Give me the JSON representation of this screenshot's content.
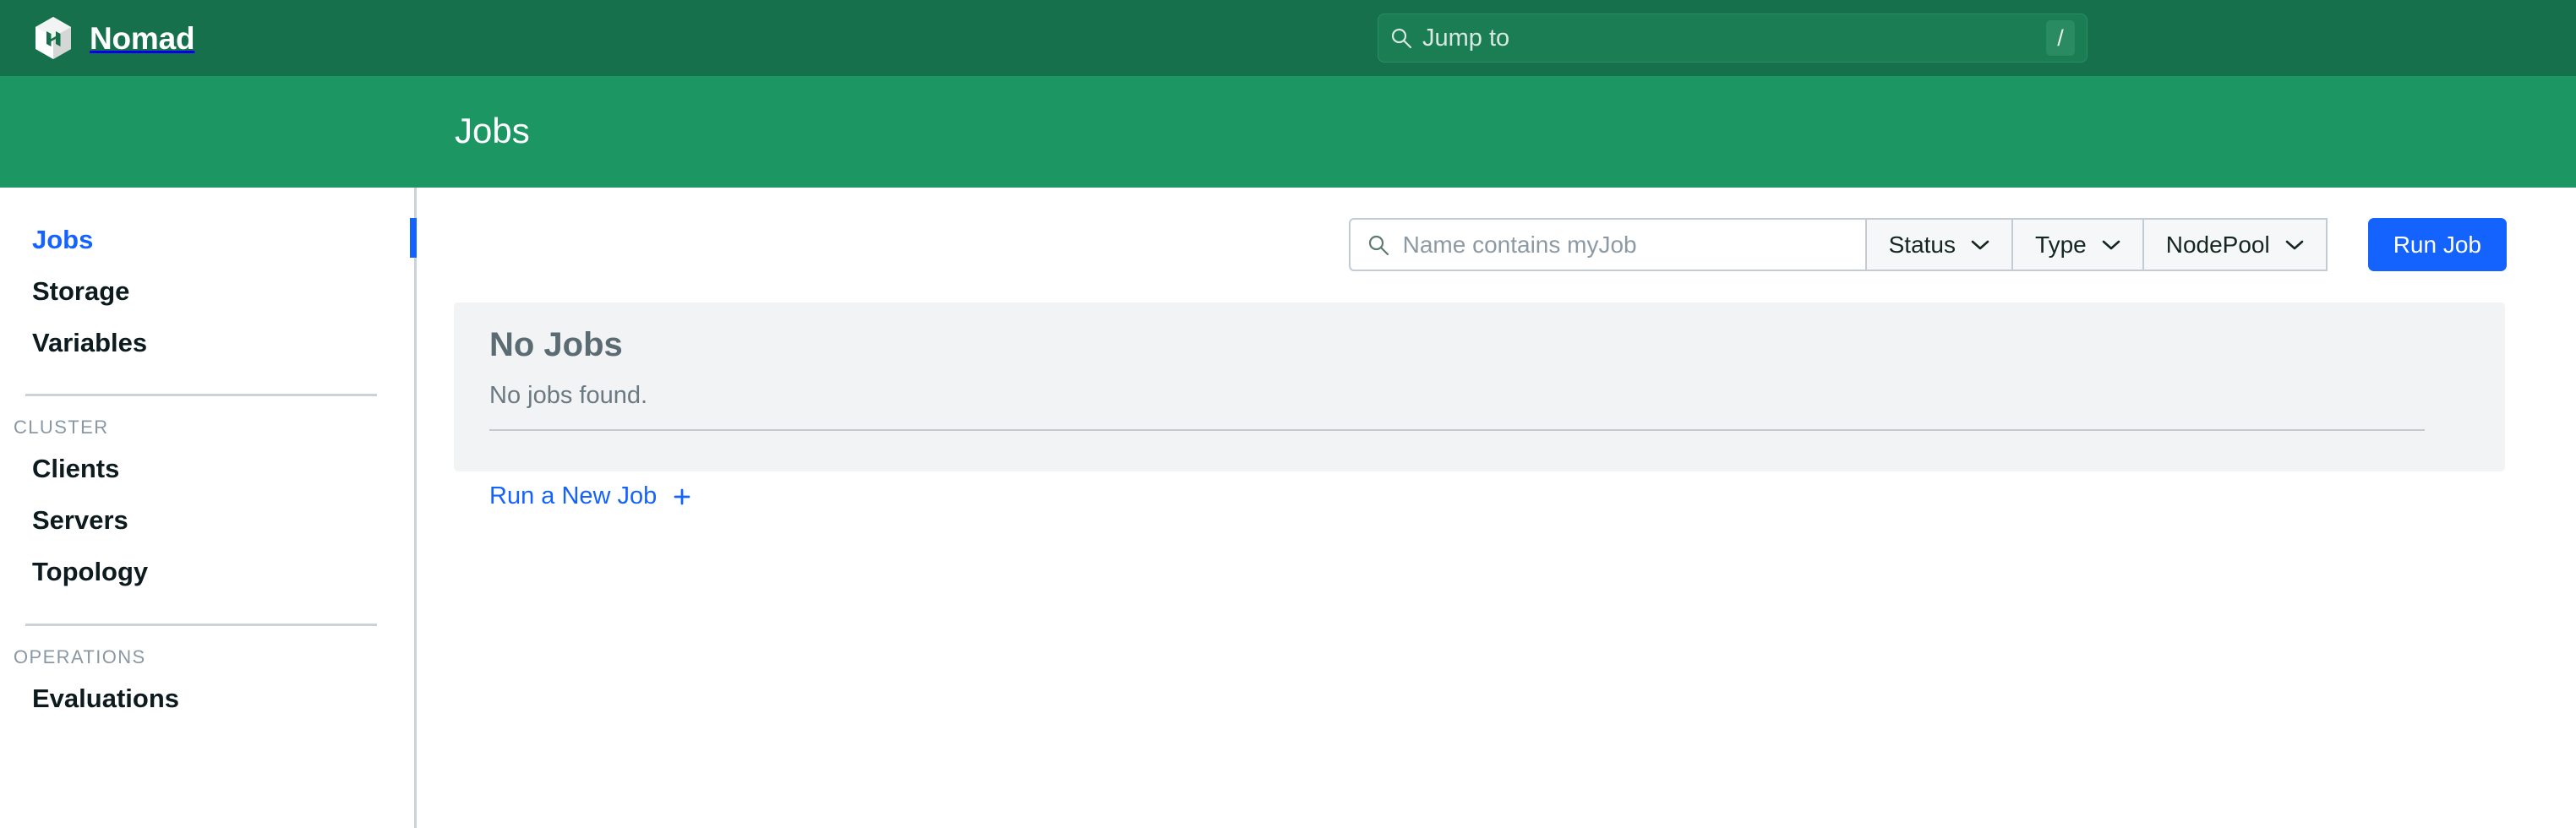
{
  "brand": {
    "name": "Nomad",
    "logo_icon": "nomad-cube-logo-icon"
  },
  "global_search": {
    "label": "Jump to",
    "placeholder": "Jump to",
    "shortcut": "/",
    "icon": "search-icon"
  },
  "header": {
    "title": "Jobs"
  },
  "sidebar": {
    "primary_items": [
      {
        "label": "Jobs",
        "active": true
      },
      {
        "label": "Storage",
        "active": false
      },
      {
        "label": "Variables",
        "active": false
      }
    ],
    "sections": [
      {
        "label": "CLUSTER",
        "items": [
          {
            "label": "Clients"
          },
          {
            "label": "Servers"
          },
          {
            "label": "Topology"
          }
        ]
      },
      {
        "label": "OPERATIONS",
        "items": [
          {
            "label": "Evaluations"
          }
        ]
      }
    ]
  },
  "toolbar": {
    "search": {
      "value": "",
      "placeholder": "Name contains myJob",
      "icon": "search-icon"
    },
    "filters": [
      {
        "label": "Status",
        "icon": "chevron-down-icon"
      },
      {
        "label": "Type",
        "icon": "chevron-down-icon"
      },
      {
        "label": "NodePool",
        "icon": "chevron-down-icon"
      }
    ],
    "run_job_label": "Run Job"
  },
  "empty_state": {
    "title": "No Jobs",
    "message": "No jobs found.",
    "action_label": "Run a New Job",
    "action_icon": "plus-icon"
  },
  "colors": {
    "nav_green": "#15704b",
    "subnav_green": "#1c9663",
    "accent_blue": "#1563ff",
    "panel_gray": "#f2f3f4",
    "border_gray": "#c9d3d8"
  }
}
